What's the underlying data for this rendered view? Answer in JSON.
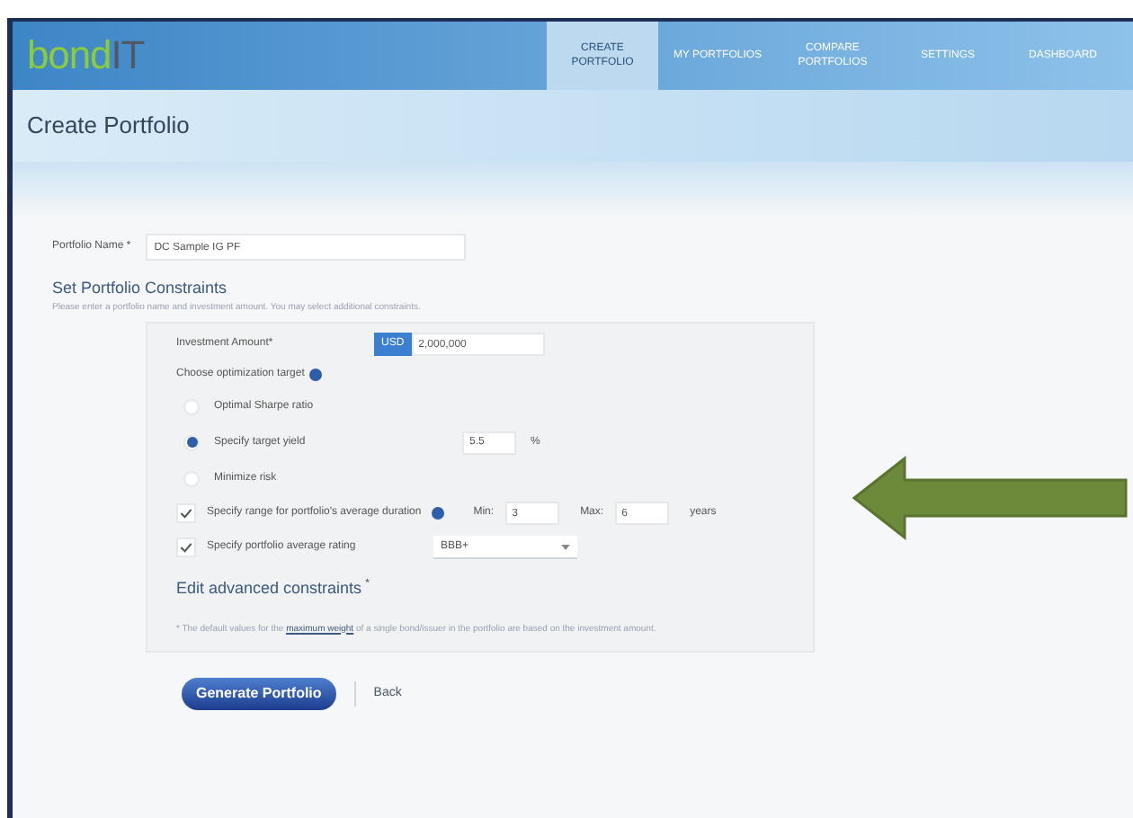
{
  "header": {
    "logo": {
      "first": "bond",
      "second": "IT"
    },
    "nav": [
      {
        "label": "CREATE PORTFOLIO",
        "selected": true
      },
      {
        "label": "MY PORTFOLIOS",
        "selected": false
      },
      {
        "label": "COMPARE PORTFOLIOS",
        "selected": false
      },
      {
        "label": "SETTINGS",
        "selected": false
      },
      {
        "label": "DASHBOARD",
        "selected": false
      }
    ]
  },
  "page_title": "Create Portfolio",
  "form": {
    "portfolio_name": {
      "label": "Portfolio Name *",
      "value": "DC Sample IG PF"
    },
    "section_title": "Set Portfolio Constraints",
    "hint": "Please enter a portfolio name and investment amount. You may select additional constraints.",
    "investment": {
      "label": "Investment Amount*",
      "currency": "USD",
      "value": "2,000,000"
    },
    "target": {
      "label": "Choose optimization target"
    },
    "options": [
      {
        "label": "Optimal Sharpe ratio",
        "selected": false
      },
      {
        "label": "Specify target yield",
        "selected": true,
        "value": "5.5",
        "unit": "%"
      },
      {
        "label": "Minimize risk",
        "selected": false
      }
    ],
    "duration": {
      "checked": true,
      "label": "Specify range for portfolio's average duration",
      "min_label": "Min:",
      "min": "3",
      "max_label": "Max:",
      "max": "6",
      "unit": "years"
    },
    "rating": {
      "checked": true,
      "label": "Specify portfolio average rating",
      "value": "BBB+"
    },
    "advanced": "Edit advanced constraints",
    "advanced_mark": "*",
    "footnote": {
      "before": "* The default values for the",
      "link": "maximum weight",
      "after": "of a single bond/issuer in the portfolio are based on the investment amount."
    }
  },
  "buttons": {
    "generate": "Generate Portfolio",
    "back": "Back"
  }
}
